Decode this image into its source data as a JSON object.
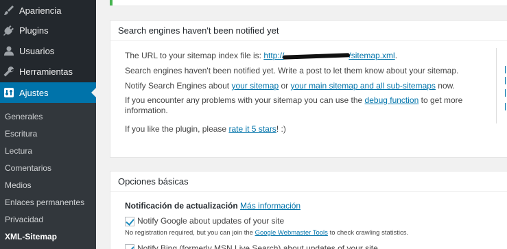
{
  "sidebar": {
    "items": [
      {
        "label": "Apariencia",
        "icon": "paintbrush-icon"
      },
      {
        "label": "Plugins",
        "icon": "plug-icon"
      },
      {
        "label": "Usuarios",
        "icon": "users-icon"
      },
      {
        "label": "Herramientas",
        "icon": "wrench-icon"
      },
      {
        "label": "Ajustes",
        "icon": "settings-icon"
      }
    ],
    "submenu": [
      "Generales",
      "Escritura",
      "Lectura",
      "Comentarios",
      "Medios",
      "Enlaces permanentes",
      "Privacidad",
      "XML-Sitemap"
    ]
  },
  "status_panel": {
    "title": "Search engines haven't been notified yet",
    "url_prefix": "The URL to your sitemap index file is:",
    "url_start": "http://",
    "url_end": "/sitemap.xml",
    "url_suffix": ".",
    "not_notified": "Search engines haven't been notified yet. Write a post to let them know about your sitemap.",
    "notify_prefix": "Notify Search Engines about",
    "your_sitemap_link": "your sitemap",
    "or_text": "or",
    "main_sitemap_link": "your main sitemap and all sub-sitemaps",
    "now_text": "now.",
    "problems_prefix": "If you encounter any problems with your sitemap you can use the",
    "debug_link": "debug function",
    "problems_suffix": "to get more",
    "information_text": "information.",
    "like_prefix": "If you like the plugin, please",
    "rate_link": "rate it 5 stars",
    "like_suffix": "! :)"
  },
  "basic_panel": {
    "title": "Opciones básicas",
    "section_label": "Notificación de actualización",
    "more_info_link": "Más información",
    "google_label": "Notify Google about updates of your site",
    "google_note_prefix": "No registration required, but you can join the",
    "google_tools_link": "Google Webmaster Tools",
    "google_note_suffix": "to check crawling statistics.",
    "bing_label": "Notify Bing (formerly MSN Live Search) about updates of your site"
  },
  "colors": {
    "sidebar": "#23282d",
    "active": "#0073aa",
    "link": "#0073aa",
    "success": "#46b450"
  }
}
